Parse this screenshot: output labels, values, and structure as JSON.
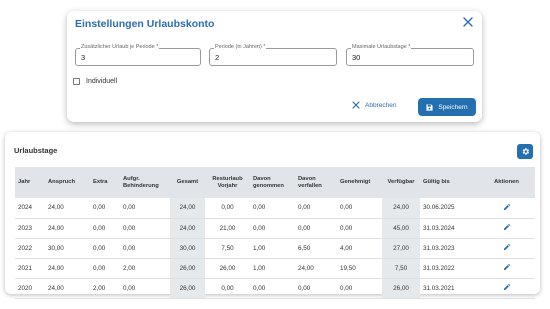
{
  "dialog": {
    "title": "Einstellungen Urlaubskonto",
    "fields": [
      {
        "label": "Zusätzlicher Urlaub je Periode *",
        "value": "3"
      },
      {
        "label": "Periode (in Jahren) *",
        "value": "2"
      },
      {
        "label": "Maximale Urlaubstage *",
        "value": "30"
      }
    ],
    "checkbox_label": "Individuell",
    "cancel_label": "Abbrechen",
    "save_label": "Speichern"
  },
  "panel": {
    "title": "Urlaubstage",
    "columns": [
      "Jahr",
      "Anspruch",
      "Extra",
      "Aufgr. Behinderung",
      "Gesamt",
      "Resturlaub Vorjahr",
      "Davon genommen",
      "Davon verfallen",
      "Genehmigt",
      "Verfügbar",
      "Gültig bis",
      "Aktionen"
    ],
    "rows": [
      [
        "2024",
        "24,00",
        "0,00",
        "0,00",
        "24,00",
        "0,00",
        "0,00",
        "0,00",
        "0,00",
        "24,00",
        "30.06.2025"
      ],
      [
        "2023",
        "24,00",
        "0,00",
        "0,00",
        "24,00",
        "21,00",
        "0,00",
        "0,00",
        "0,00",
        "45,00",
        "31.03.2024"
      ],
      [
        "2022",
        "30,00",
        "0,00",
        "0,00",
        "30,00",
        "7,50",
        "1,00",
        "6,50",
        "4,00",
        "27,00",
        "31.03.2023"
      ],
      [
        "2021",
        "24,00",
        "0,00",
        "2,00",
        "26,00",
        "26,00",
        "1,00",
        "24,00",
        "19,50",
        "7,50",
        "31.03.2022"
      ],
      [
        "2020",
        "24,00",
        "2,00",
        "0,00",
        "26,00",
        "0,00",
        "0,00",
        "0,00",
        "0,00",
        "26,00",
        "31.03.2021"
      ]
    ]
  },
  "icons": {
    "close": "close-icon",
    "cancel": "x-icon",
    "save": "floppy-disk-icon",
    "settings": "gear-icon",
    "edit": "pencil-icon"
  },
  "colors": {
    "accent": "#236fb0",
    "title_blue": "#2a6db0",
    "header_bg": "#e1e5e9",
    "shaded_column": "#e6e9ec"
  }
}
